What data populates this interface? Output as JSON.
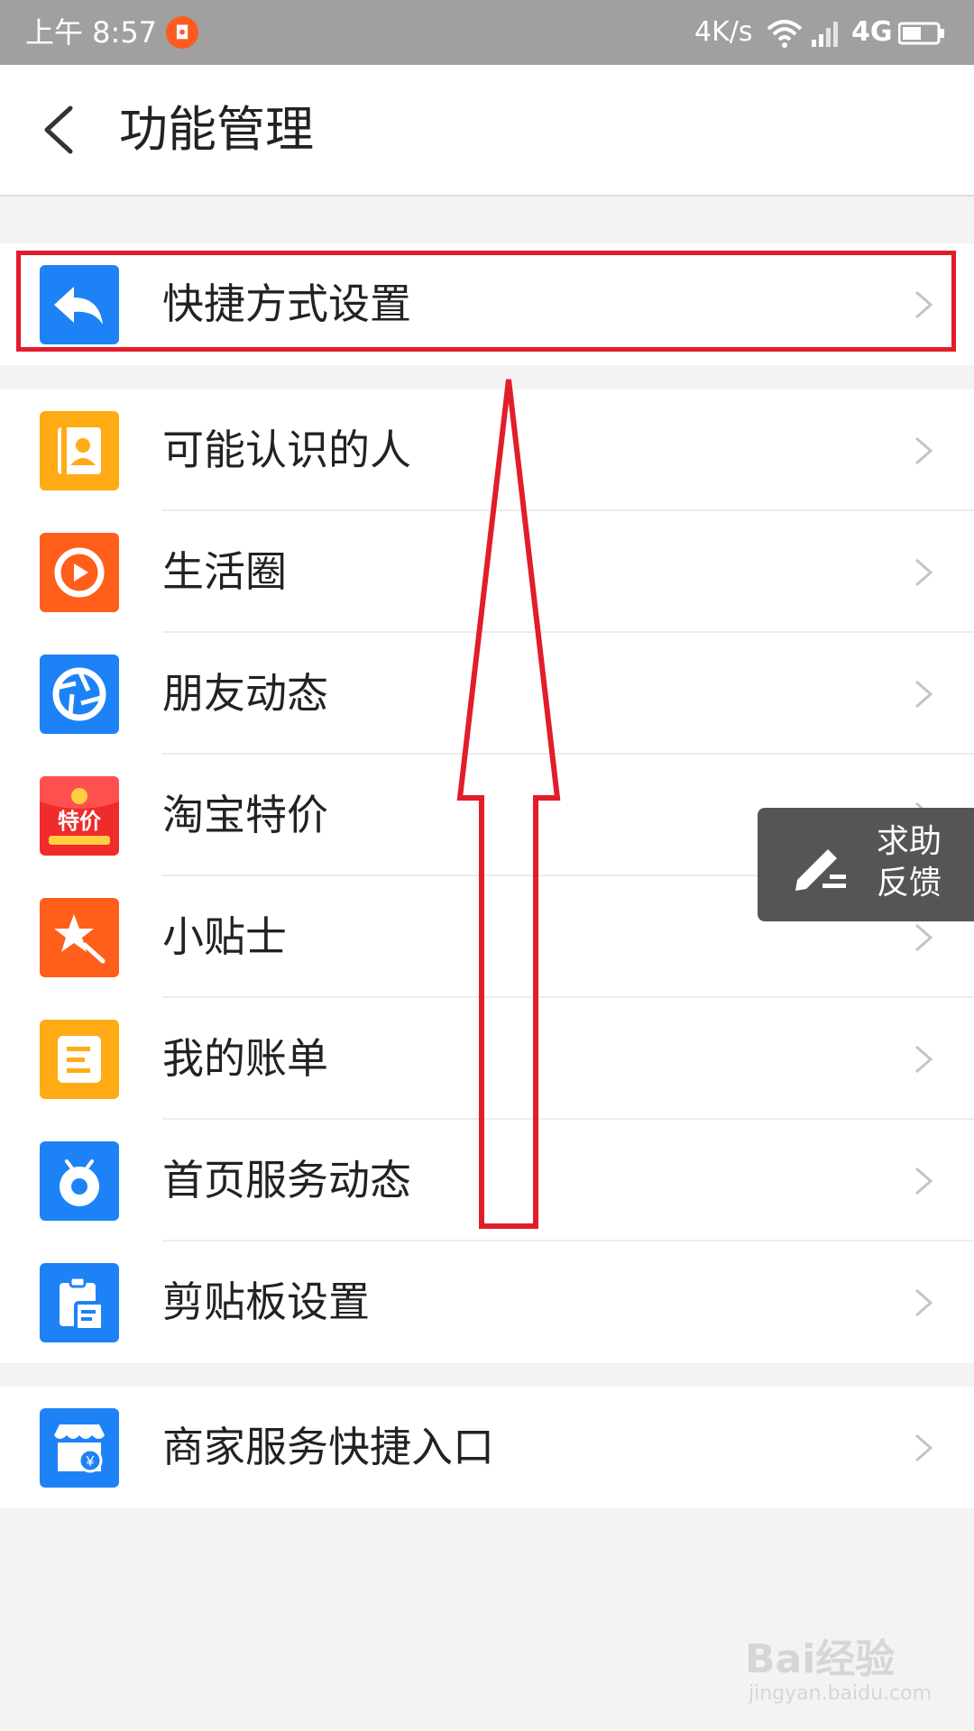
{
  "status_bar": {
    "time": "上午 8:57",
    "net_speed": "4K/s",
    "network": "4G"
  },
  "header": {
    "title": "功能管理"
  },
  "groups": [
    {
      "items": [
        {
          "label": "快捷方式设置",
          "icon": "reply-arrow-icon",
          "color": "#1e82f7"
        }
      ]
    },
    {
      "items": [
        {
          "label": "可能认识的人",
          "icon": "contact-card-icon",
          "color": "#ffab16"
        },
        {
          "label": "生活圈",
          "icon": "life-circle-icon",
          "color": "#ff5e1b"
        },
        {
          "label": "朋友动态",
          "icon": "shutter-icon",
          "color": "#1e82f7"
        },
        {
          "label": "淘宝特价",
          "icon": "red-envelope-icon",
          "color": "#ef2b2b",
          "icon_text": "特价"
        },
        {
          "label": "小贴士",
          "icon": "star-wand-icon",
          "color": "#ff5e1b"
        },
        {
          "label": "我的账单",
          "icon": "bill-icon",
          "color": "#ffab16"
        },
        {
          "label": "首页服务动态",
          "icon": "bell-icon",
          "color": "#1e82f7"
        },
        {
          "label": "剪贴板设置",
          "icon": "clipboard-icon",
          "color": "#1e82f7"
        }
      ]
    },
    {
      "items": [
        {
          "label": "商家服务快捷入口",
          "icon": "shop-icon",
          "color": "#1e82f7"
        }
      ]
    }
  ],
  "feedback": {
    "line1": "求助",
    "line2": "反馈"
  },
  "watermark": {
    "logo": "Bai经验",
    "url": "jingyan.baidu.com"
  },
  "colors": {
    "highlight": "#e21d2b",
    "arrow": "#e21d2b"
  }
}
